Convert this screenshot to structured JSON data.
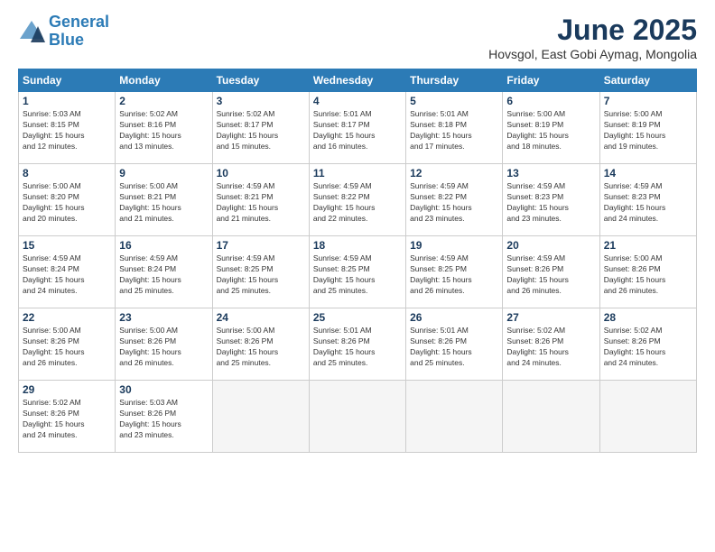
{
  "logo": {
    "line1": "General",
    "line2": "Blue"
  },
  "title": "June 2025",
  "location": "Hovsgol, East Gobi Aymag, Mongolia",
  "headers": [
    "Sunday",
    "Monday",
    "Tuesday",
    "Wednesday",
    "Thursday",
    "Friday",
    "Saturday"
  ],
  "weeks": [
    [
      {
        "day": "1",
        "info": "Sunrise: 5:03 AM\nSunset: 8:15 PM\nDaylight: 15 hours\nand 12 minutes."
      },
      {
        "day": "2",
        "info": "Sunrise: 5:02 AM\nSunset: 8:16 PM\nDaylight: 15 hours\nand 13 minutes."
      },
      {
        "day": "3",
        "info": "Sunrise: 5:02 AM\nSunset: 8:17 PM\nDaylight: 15 hours\nand 15 minutes."
      },
      {
        "day": "4",
        "info": "Sunrise: 5:01 AM\nSunset: 8:17 PM\nDaylight: 15 hours\nand 16 minutes."
      },
      {
        "day": "5",
        "info": "Sunrise: 5:01 AM\nSunset: 8:18 PM\nDaylight: 15 hours\nand 17 minutes."
      },
      {
        "day": "6",
        "info": "Sunrise: 5:00 AM\nSunset: 8:19 PM\nDaylight: 15 hours\nand 18 minutes."
      },
      {
        "day": "7",
        "info": "Sunrise: 5:00 AM\nSunset: 8:19 PM\nDaylight: 15 hours\nand 19 minutes."
      }
    ],
    [
      {
        "day": "8",
        "info": "Sunrise: 5:00 AM\nSunset: 8:20 PM\nDaylight: 15 hours\nand 20 minutes."
      },
      {
        "day": "9",
        "info": "Sunrise: 5:00 AM\nSunset: 8:21 PM\nDaylight: 15 hours\nand 21 minutes."
      },
      {
        "day": "10",
        "info": "Sunrise: 4:59 AM\nSunset: 8:21 PM\nDaylight: 15 hours\nand 21 minutes."
      },
      {
        "day": "11",
        "info": "Sunrise: 4:59 AM\nSunset: 8:22 PM\nDaylight: 15 hours\nand 22 minutes."
      },
      {
        "day": "12",
        "info": "Sunrise: 4:59 AM\nSunset: 8:22 PM\nDaylight: 15 hours\nand 23 minutes."
      },
      {
        "day": "13",
        "info": "Sunrise: 4:59 AM\nSunset: 8:23 PM\nDaylight: 15 hours\nand 23 minutes."
      },
      {
        "day": "14",
        "info": "Sunrise: 4:59 AM\nSunset: 8:23 PM\nDaylight: 15 hours\nand 24 minutes."
      }
    ],
    [
      {
        "day": "15",
        "info": "Sunrise: 4:59 AM\nSunset: 8:24 PM\nDaylight: 15 hours\nand 24 minutes."
      },
      {
        "day": "16",
        "info": "Sunrise: 4:59 AM\nSunset: 8:24 PM\nDaylight: 15 hours\nand 25 minutes."
      },
      {
        "day": "17",
        "info": "Sunrise: 4:59 AM\nSunset: 8:25 PM\nDaylight: 15 hours\nand 25 minutes."
      },
      {
        "day": "18",
        "info": "Sunrise: 4:59 AM\nSunset: 8:25 PM\nDaylight: 15 hours\nand 25 minutes."
      },
      {
        "day": "19",
        "info": "Sunrise: 4:59 AM\nSunset: 8:25 PM\nDaylight: 15 hours\nand 26 minutes."
      },
      {
        "day": "20",
        "info": "Sunrise: 4:59 AM\nSunset: 8:26 PM\nDaylight: 15 hours\nand 26 minutes."
      },
      {
        "day": "21",
        "info": "Sunrise: 5:00 AM\nSunset: 8:26 PM\nDaylight: 15 hours\nand 26 minutes."
      }
    ],
    [
      {
        "day": "22",
        "info": "Sunrise: 5:00 AM\nSunset: 8:26 PM\nDaylight: 15 hours\nand 26 minutes."
      },
      {
        "day": "23",
        "info": "Sunrise: 5:00 AM\nSunset: 8:26 PM\nDaylight: 15 hours\nand 26 minutes."
      },
      {
        "day": "24",
        "info": "Sunrise: 5:00 AM\nSunset: 8:26 PM\nDaylight: 15 hours\nand 25 minutes."
      },
      {
        "day": "25",
        "info": "Sunrise: 5:01 AM\nSunset: 8:26 PM\nDaylight: 15 hours\nand 25 minutes."
      },
      {
        "day": "26",
        "info": "Sunrise: 5:01 AM\nSunset: 8:26 PM\nDaylight: 15 hours\nand 25 minutes."
      },
      {
        "day": "27",
        "info": "Sunrise: 5:02 AM\nSunset: 8:26 PM\nDaylight: 15 hours\nand 24 minutes."
      },
      {
        "day": "28",
        "info": "Sunrise: 5:02 AM\nSunset: 8:26 PM\nDaylight: 15 hours\nand 24 minutes."
      }
    ],
    [
      {
        "day": "29",
        "info": "Sunrise: 5:02 AM\nSunset: 8:26 PM\nDaylight: 15 hours\nand 24 minutes."
      },
      {
        "day": "30",
        "info": "Sunrise: 5:03 AM\nSunset: 8:26 PM\nDaylight: 15 hours\nand 23 minutes."
      },
      {
        "day": "",
        "info": ""
      },
      {
        "day": "",
        "info": ""
      },
      {
        "day": "",
        "info": ""
      },
      {
        "day": "",
        "info": ""
      },
      {
        "day": "",
        "info": ""
      }
    ]
  ]
}
